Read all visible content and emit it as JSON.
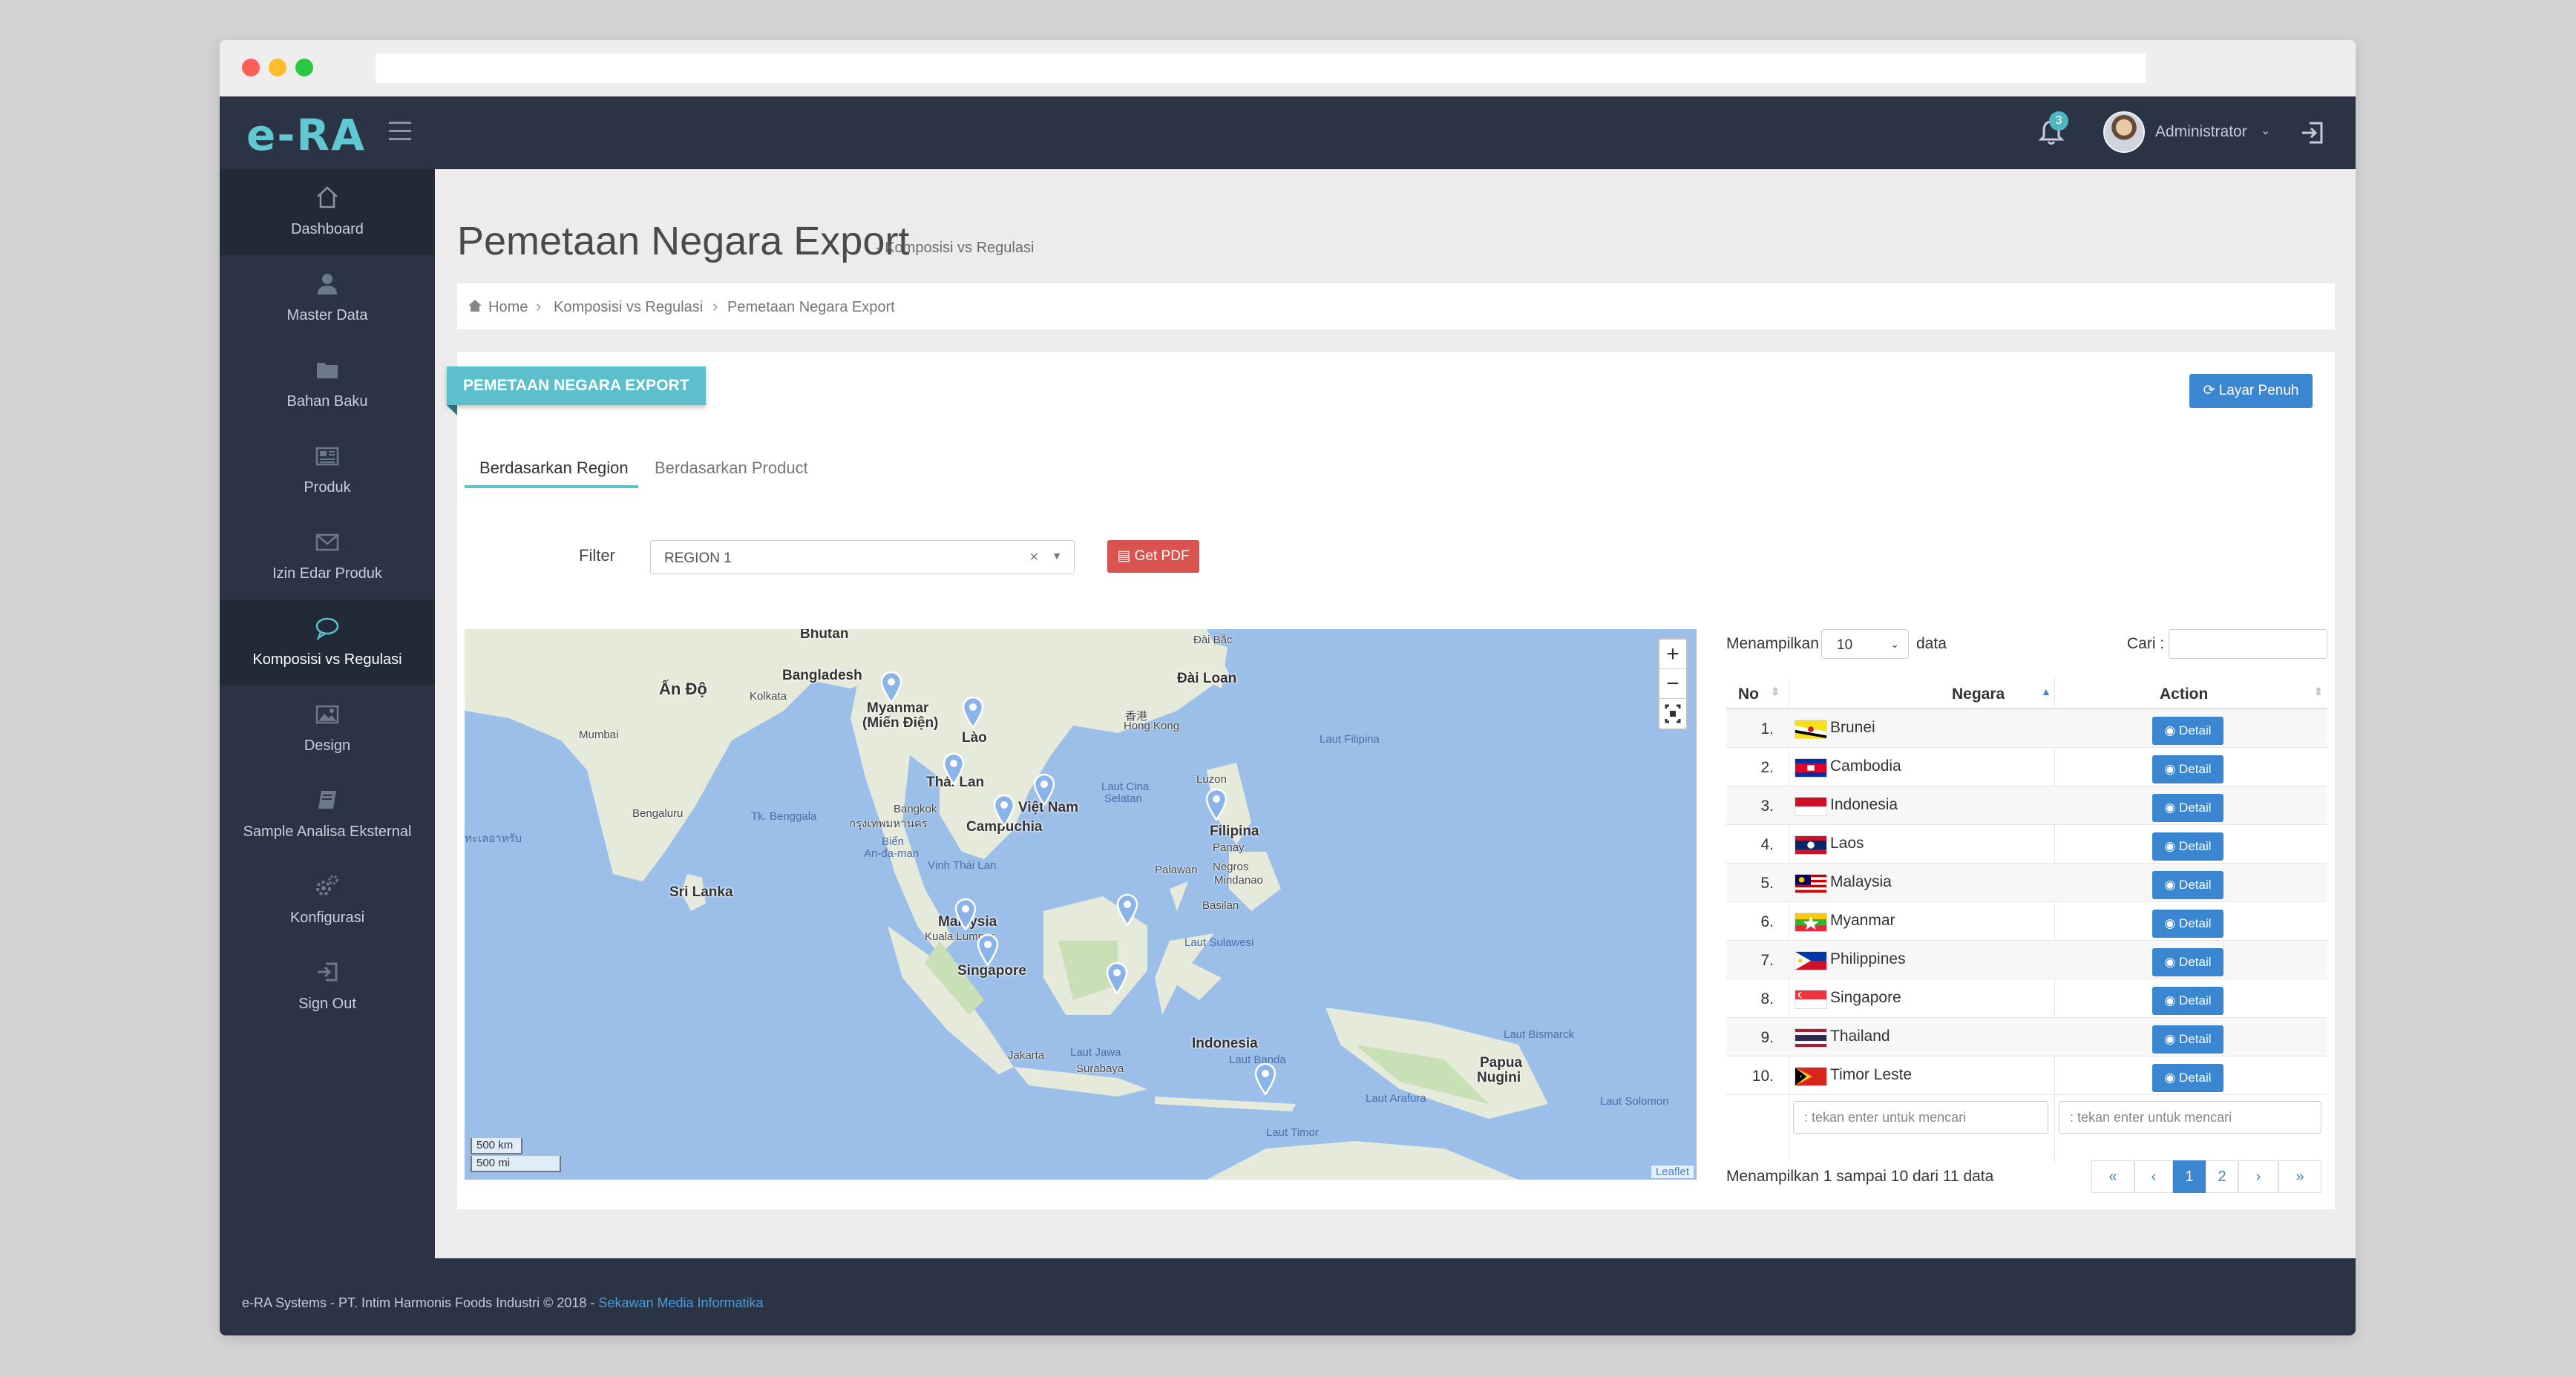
{
  "app": {
    "logo": "e-RA",
    "notification_count": "3",
    "user_name": "Administrator"
  },
  "sidebar": {
    "items": [
      {
        "label": "Dashboard",
        "icon": "home-icon"
      },
      {
        "label": "Master Data",
        "icon": "user-icon"
      },
      {
        "label": "Bahan Baku",
        "icon": "folder-icon"
      },
      {
        "label": "Produk",
        "icon": "newspaper-icon"
      },
      {
        "label": "Izin Edar Produk",
        "icon": "envelope-icon"
      },
      {
        "label": "Komposisi vs Regulasi",
        "icon": "comment-icon"
      },
      {
        "label": "Design",
        "icon": "image-icon"
      },
      {
        "label": "Sample Analisa Eksternal",
        "icon": "book-icon"
      },
      {
        "label": "Konfigurasi",
        "icon": "gears-icon"
      },
      {
        "label": "Sign Out",
        "icon": "sign-out-icon"
      }
    ]
  },
  "page": {
    "title": "Pemetaan Negara Export",
    "subtitle": "- Komposisi vs Regulasi",
    "breadcrumb": [
      "Home",
      "Komposisi vs Regulasi",
      "Pemetaan Negara Export"
    ]
  },
  "panel": {
    "ribbon": "PEMETAAN NEGARA EXPORT",
    "fullscreen_label": "Layar Penuh",
    "tabs": [
      "Berdasarkan Region",
      "Berdasarkan Product"
    ],
    "filter_label": "Filter",
    "filter_value": "REGION 1",
    "pdf_label": "Get PDF"
  },
  "map": {
    "zoom_in": "+",
    "zoom_out": "−",
    "scale_km": "500 km",
    "scale_mi": "500 mi",
    "attribution": "Leaflet",
    "labels": {
      "bhutan": "Bhutan",
      "an_do": "Ấn Độ",
      "bangladesh": "Bangladesh",
      "kolkata": "Kolkata",
      "myanmar": "Myanmar",
      "mien_dien": "(Miến Điện)",
      "lao": "Lào",
      "dai_bac": "Đài Bắc",
      "dai_loan": "Đài Loan",
      "hong_kong_cn": "香港",
      "hong_kong": "Hong Kong",
      "mumbai": "Mumbai",
      "thai_lan": "Thái Lan",
      "viet_nam": "Việt Nam",
      "laut_cina": "Laut Cina",
      "selatan": "Selatan",
      "luzon": "Luzon",
      "laut_filipina": "Laut Filipina",
      "bengaluru": "Bengaluru",
      "tk_benggala": "Tk. Benggala",
      "bangkok": "Bangkok",
      "bangkok_th": "กรุงเทพมหานคร",
      "campuchia": "Campuchia",
      "filipina": "Filipina",
      "panay": "Panay",
      "negros": "Negros",
      "mindanao": "Mindanao",
      "palawan": "Palawan",
      "basilan": "Basilan",
      "bien": "Biển",
      "an_da_man": "An-đa-man",
      "vinh_thai_lan": "Vịnh Thái Lan",
      "indian_thai": "ทะเลอาหรับ",
      "sri_lanka": "Sri Lanka",
      "malaysia": "Malaysia",
      "kuala_lumpur": "Kuala Lumpur",
      "singapore": "Singapore",
      "laut_sulawesi": "Laut Sulawesi",
      "jakarta": "Jakarta",
      "laut_jawa": "Laut Jawa",
      "surabaya": "Surabaya",
      "indonesia": "Indonesia",
      "laut_banda": "Laut Banda",
      "laut_bismarck": "Laut Bismarck",
      "papua": "Papua",
      "nugini": "Nugini",
      "laut_arafura": "Laut Arafura",
      "laut_solomon": "Laut Solomon",
      "laut_timor": "Laut Timor"
    }
  },
  "table": {
    "show_label": "Menampilkan",
    "page_size": "10",
    "data_label": "data",
    "search_label": "Cari :",
    "columns": [
      "No",
      "Negara",
      "Action"
    ],
    "detail_label": "Detail",
    "rows": [
      {
        "no": "1.",
        "name": "Brunei"
      },
      {
        "no": "2.",
        "name": "Cambodia"
      },
      {
        "no": "3.",
        "name": "Indonesia"
      },
      {
        "no": "4.",
        "name": "Laos"
      },
      {
        "no": "5.",
        "name": "Malaysia"
      },
      {
        "no": "6.",
        "name": "Myanmar"
      },
      {
        "no": "7.",
        "name": "Philippines"
      },
      {
        "no": "8.",
        "name": "Singapore"
      },
      {
        "no": "9.",
        "name": "Thailand"
      },
      {
        "no": "10.",
        "name": "Timor Leste"
      }
    ],
    "search_placeholder": ": tekan enter untuk mencari",
    "info": "Menampilkan 1 sampai 10 dari 11 data",
    "pagination": [
      "«",
      "‹",
      "1",
      "2",
      "›",
      "»"
    ]
  },
  "footer": {
    "text": "e-RA Systems - PT. Intim Harmonis Foods Industri © 2018 - ",
    "link": "Sekawan Media Informatika"
  },
  "colors": {
    "topbar": "#2b3445",
    "accent": "#5bbfcc",
    "primary": "#3a86d0",
    "danger": "#d9534f",
    "sea": "#9bbfe9",
    "land": "#e6eadb"
  }
}
